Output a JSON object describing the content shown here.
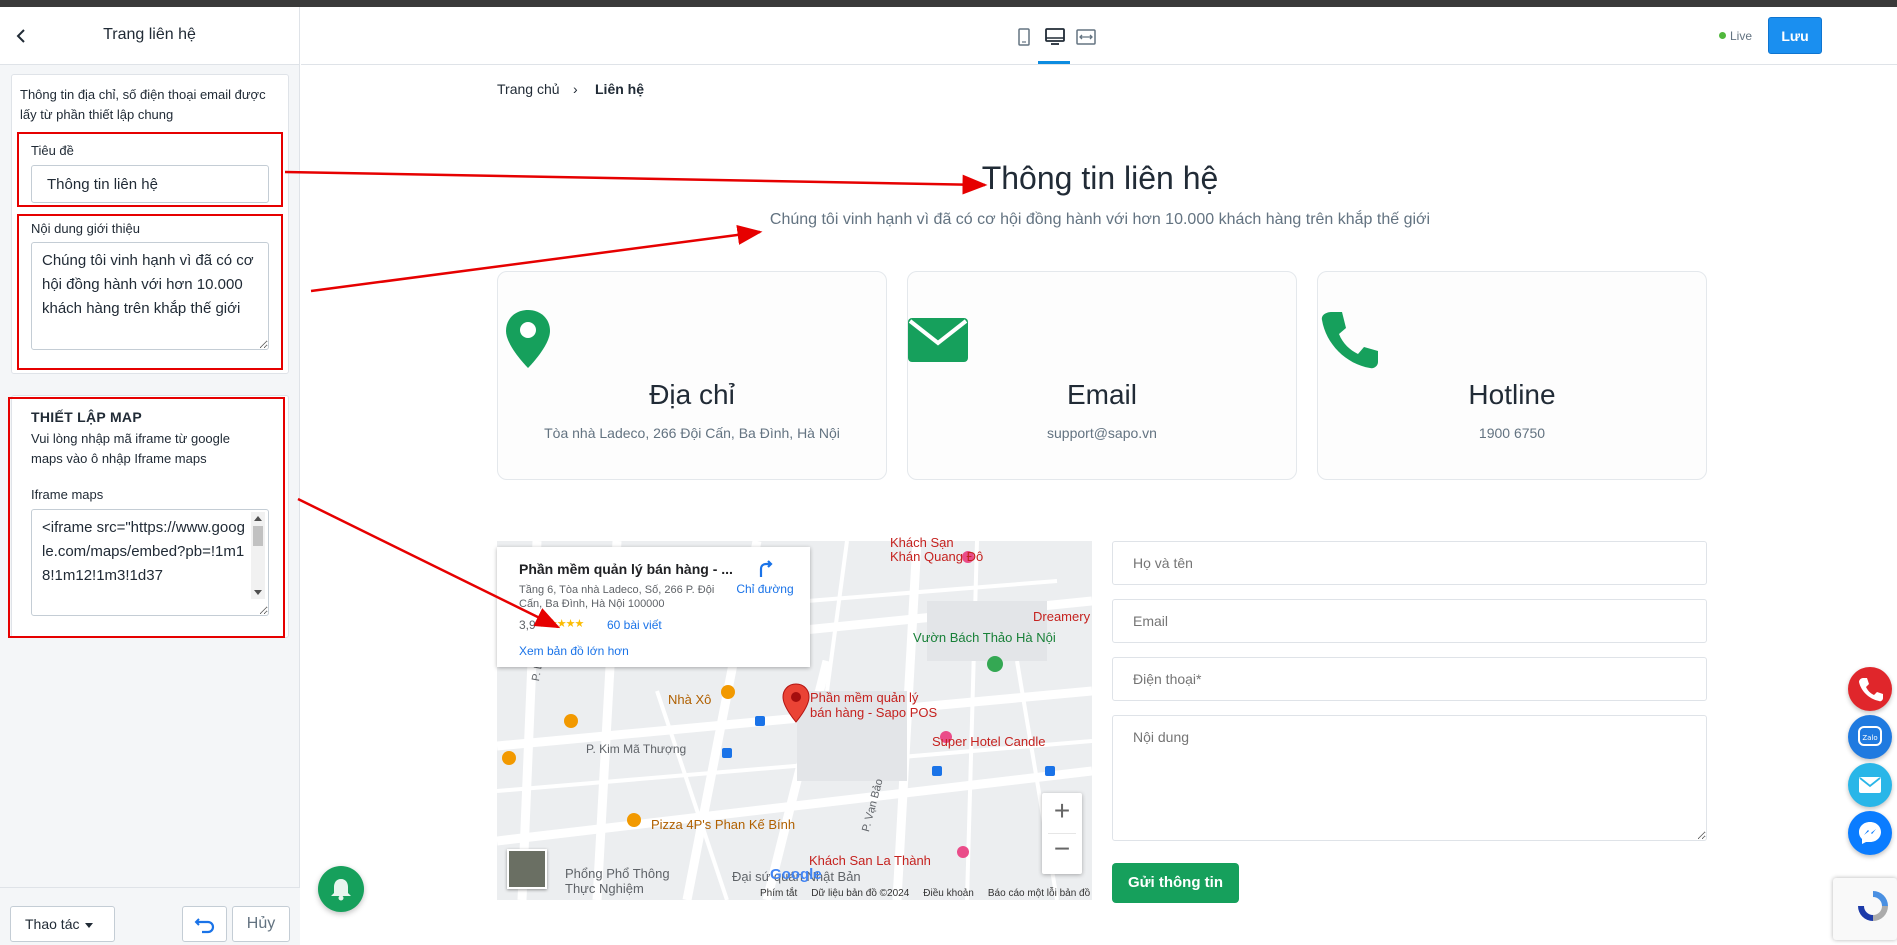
{
  "panel": {
    "title": "Trang liên hệ",
    "note": "Thông tin địa chỉ, số điện thoại email được lấy từ phần thiết lập chung",
    "title_label": "Tiêu đề",
    "title_value": "Thông tin liên hệ",
    "intro_label": "Nội dung giới thiệu",
    "intro_value": "Chúng tôi vinh hạnh vì đã có cơ hội đồng hành với hơn 10.000 khách hàng trên khắp thế giới",
    "map_section_title": "THIẾT LẬP MAP",
    "map_section_note": "Vui lòng nhập mã iframe từ google maps vào ô nhập Iframe maps",
    "iframe_label": "Iframe maps",
    "iframe_value": "<iframe src=\"https://www.google.com/maps/embed?pb=!1m18!1m12!1m3!1d37",
    "footer": {
      "action_label": "Thao tác",
      "cancel_label": "Hủy"
    }
  },
  "topbar": {
    "live_label": "Live",
    "save_label": "Lưu"
  },
  "breadcrumb": {
    "home": "Trang chủ",
    "separator": "›",
    "current": "Liên hệ"
  },
  "content": {
    "heading": "Thông tin liên hệ",
    "subheading": "Chúng tôi vinh hạnh vì đã có cơ hội đồng hành với hơn 10.000 khách hàng trên khắp thế giới",
    "cards": [
      {
        "icon": "location-pin-icon",
        "title": "Địa chỉ",
        "detail": "Tòa nhà Ladeco, 266 Đội Cấn, Ba Đình, Hà Nội"
      },
      {
        "icon": "envelope-icon",
        "title": "Email",
        "detail": "support@sapo.vn"
      },
      {
        "icon": "phone-icon",
        "title": "Hotline",
        "detail": "1900 6750"
      }
    ]
  },
  "map": {
    "place_title": "Phần mềm quản lý bán hàng - ...",
    "place_address": "Tầng 6, Tòa nhà Ladeco, Số, 266 P. Đội Cấn, Ba Đình, Hà Nội 100000",
    "directions": "Chỉ đường",
    "rating": "3,9",
    "stars": "★★★★★",
    "reviews": "60 bài viết",
    "larger_map": "Xem bản đồ lớn hơn",
    "labels": {
      "khach_san_khan": "Khách Sạn\nKhán Quang Đô",
      "vuon_bach_thao": "Vườn Bách Thảo Hà Nội",
      "dreamery": "Dreamery",
      "nha_xo": "Nhà Xô",
      "pin_label": "Phần mềm quản lý\nbán hàng - Sapo POS",
      "super_hotel": "Super Hotel Candle",
      "linh_lang": "P. Linh Lang",
      "kim_ma_thuong": "P. Kim Mã Thượng",
      "van_bao": "P. Vạn Bảo",
      "pizza": "Pizza 4P's Phan Kế Bính",
      "ks_la_thanh": "Khách San La Thành",
      "pho_thong": "Phổng Phổ Thông\nThực Nghiệm",
      "dai_su_quan": "Đại sứ quán Nhật Bản",
      "google": "Google"
    },
    "footer_links": [
      "Phím tắt",
      "Dữ liệu bản đồ ©2024",
      "Điều khoản",
      "Báo cáo một lỗi bản đồ"
    ],
    "zoom_in": "+",
    "zoom_out": "−"
  },
  "form": {
    "name_placeholder": "Họ và tên",
    "email_placeholder": "Email",
    "phone_placeholder": "Điện thoại*",
    "content_placeholder": "Nội dung",
    "submit_label": "Gửi thông tin"
  },
  "floating": {
    "zalo_label": "Zalo"
  },
  "colors": {
    "accent_green": "#16a05c",
    "save_blue": "#1a8ff0",
    "annotation_red": "#e60000"
  }
}
